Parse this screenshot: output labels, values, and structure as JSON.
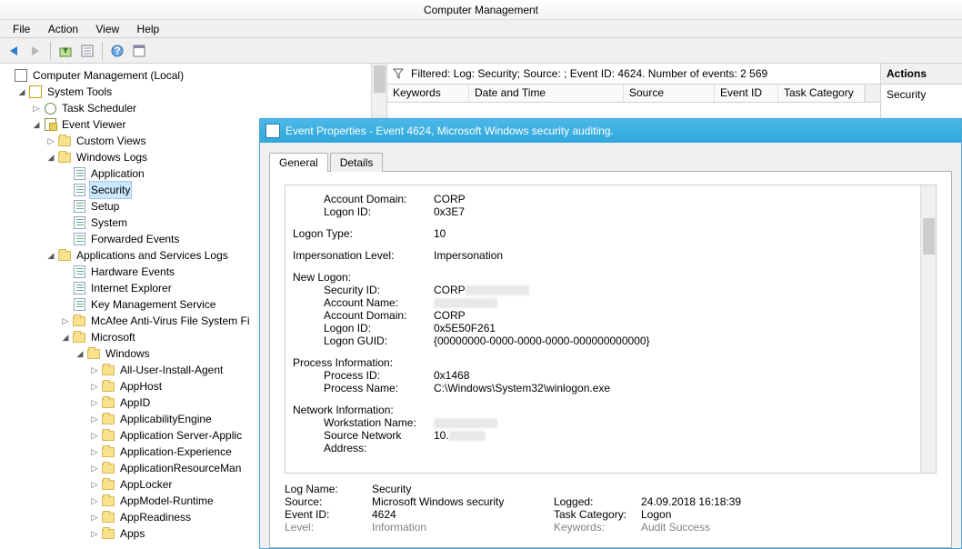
{
  "window": {
    "title": "Computer Management"
  },
  "menu": {
    "file": "File",
    "action": "Action",
    "view": "View",
    "help": "Help"
  },
  "tree": {
    "root": "Computer Management (Local)",
    "system_tools": "System Tools",
    "task_scheduler": "Task Scheduler",
    "event_viewer": "Event Viewer",
    "custom_views": "Custom Views",
    "windows_logs": "Windows Logs",
    "application": "Application",
    "security": "Security",
    "setup": "Setup",
    "system": "System",
    "forwarded": "Forwarded Events",
    "apps_services": "Applications and Services Logs",
    "hardware_events": "Hardware Events",
    "internet_explorer": "Internet Explorer",
    "key_mgmt": "Key Management Service",
    "mcafee": "McAfee Anti-Virus File System Fi",
    "microsoft": "Microsoft",
    "windows": "Windows",
    "all_user_install_agent": "All-User-Install-Agent",
    "apphost": "AppHost",
    "appid": "AppID",
    "applicability": "ApplicabilityEngine",
    "app_server_applic": "Application Server-Applic",
    "app_experience": "Application-Experience",
    "app_resource_man": "ApplicationResourceMan",
    "applocker": "AppLocker",
    "appmodel_runtime": "AppModel-Runtime",
    "appreadiness": "AppReadiness",
    "apps": "Apps"
  },
  "center": {
    "filter_text": "Filtered: Log: Security; Source: ; Event ID: 4624. Number of events: 2 569",
    "col_keywords": "Keywords",
    "col_datetime": "Date and Time",
    "col_source": "Source",
    "col_eventid": "Event ID",
    "col_taskcat": "Task Category"
  },
  "actions": {
    "header": "Actions",
    "security": "Security"
  },
  "dialog": {
    "title": "Event Properties - Event 4624, Microsoft Windows security auditing.",
    "tab_general": "General",
    "tab_details": "Details",
    "account_domain_lbl": "Account Domain:",
    "account_domain_val": "CORP",
    "logon_id_lbl": "Logon ID:",
    "logon_id_val": "0x3E7",
    "logon_type_lbl": "Logon Type:",
    "logon_type_val": "10",
    "impersonation_lbl": "Impersonation Level:",
    "impersonation_val": "Impersonation",
    "new_logon_lbl": "New Logon:",
    "security_id_lbl": "Security ID:",
    "security_id_val": "CORP",
    "account_name_lbl": "Account Name:",
    "new_account_domain_lbl": "Account Domain:",
    "new_account_domain_val": "CORP",
    "new_logon_id_lbl": "Logon ID:",
    "new_logon_id_val": "0x5E50F261",
    "logon_guid_lbl": "Logon GUID:",
    "logon_guid_val": "{00000000-0000-0000-0000-000000000000}",
    "proc_info_lbl": "Process Information:",
    "proc_id_lbl": "Process ID:",
    "proc_id_val": "0x1468",
    "proc_name_lbl": "Process Name:",
    "proc_name_val": "C:\\Windows\\System32\\winlogon.exe",
    "net_info_lbl": "Network Information:",
    "workstation_lbl": "Workstation Name:",
    "src_addr_lbl": "Source Network Address:",
    "src_addr_val": "10.",
    "s_log_name_lbl": "Log Name:",
    "s_log_name_val": "Security",
    "s_source_lbl": "Source:",
    "s_source_val": "Microsoft Windows security",
    "s_logged_lbl": "Logged:",
    "s_logged_val": "24.09.2018 16:18:39",
    "s_eventid_lbl": "Event ID:",
    "s_eventid_val": "4624",
    "s_taskcat_lbl": "Task Category:",
    "s_taskcat_val": "Logon",
    "s_level_lbl": "Level:",
    "s_level_val": "Information",
    "s_keywords_lbl": "Keywords:",
    "s_keywords_val": "Audit Success"
  }
}
